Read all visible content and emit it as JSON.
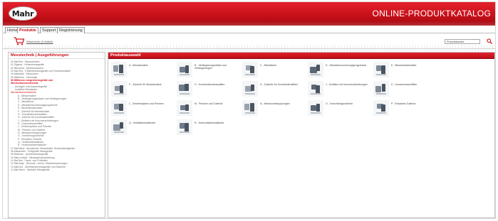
{
  "header": {
    "logo_text": "Mahr",
    "catalog_title": "ONLINE-PRODUKTKATALOG"
  },
  "nav": {
    "tabs": [
      {
        "label": "Home",
        "active": false
      },
      {
        "label": "Produkte",
        "active": true
      },
      {
        "label": "Support",
        "active": false
      },
      {
        "label": "Registrierung",
        "active": false
      }
    ]
  },
  "toolbar": {
    "cart_label": "Warenkorb (0 Artikel)",
    "search_value": "Produktsuche"
  },
  "left": {
    "title": "Messtechnik | Ausgeführungen",
    "items": [
      {
        "label": "00 MarTest - Messschieber",
        "style": "lvl1"
      },
      {
        "label": "01 Digimar - Höhenmessgeräte",
        "style": "lvl1"
      },
      {
        "label": "02 Micromar - Messschrauben",
        "style": "lvl1"
      },
      {
        "label": "03 MarTest - Fühlhebelmessgeräte und Fandmesstaster",
        "style": "lvl1"
      },
      {
        "label": "04 Marlsator - Messuhren",
        "style": "lvl1"
      },
      {
        "label": "05 Millimess - Feinzeiger",
        "style": "lvl1"
      },
      {
        "label": "06 Millimess Längenmessgeräte und",
        "style": "lvl1 red"
      },
      {
        "label": "Wechselkonverstechnik",
        "style": "lvl1 red"
      },
      {
        "label": "Anzeigen und Auswertegeräte",
        "style": "lvl2"
      },
      {
        "label": "Induktive Messtaster",
        "style": "lvl2"
      },
      {
        "label": "Wechselkonverstechnik",
        "style": "lvl1 redlink"
      },
      {
        "label": "A - Messeinsätze",
        "style": "lvl3"
      },
      {
        "label": "B - Verlängerungsstücke und Verlängerungen",
        "style": "lvl3"
      },
      {
        "label": "C - Messtische",
        "style": "lvl3"
      },
      {
        "label": "D - Messtischzuordnungsprogramme",
        "style": "lvl3"
      },
      {
        "label": "E - Blockmesseinsätze",
        "style": "lvl3"
      },
      {
        "label": "F - Zubehör für Messeinsätze",
        "style": "lvl3"
      },
      {
        "label": "G - Koordinatenmessstiften",
        "style": "lvl3"
      },
      {
        "label": "H - Zubehör für Koordinatenstiften",
        "style": "lvl3"
      },
      {
        "label": "J - Schlitten mit Kreuzverschiebungen",
        "style": "lvl3"
      },
      {
        "label": "K - Linearmessschlitten",
        "style": "lvl3"
      },
      {
        "label": "L - Zentrierspitzen und Prismen",
        "style": "lvl3"
      },
      {
        "label": "M - Prismen und Zubehör",
        "style": "lvl3"
      },
      {
        "label": "N - Messsonnekopplungen",
        "style": "lvl3"
      },
      {
        "label": "O - Vorrichtungszubehör",
        "style": "lvl3"
      },
      {
        "label": "P - Einsatzes Zubehör",
        "style": "lvl3"
      },
      {
        "label": "Q - Vertikalmessständer",
        "style": "lvl3"
      },
      {
        "label": "R - Horizontalmessständer",
        "style": "lvl3"
      },
      {
        "label": "07 MarStand - Messtische, Messstative, Rundlaufprüfgeräte",
        "style": "lvl1"
      },
      {
        "label": "08 Marameter - Prüfgeräte Messgeräte",
        "style": "lvl1"
      },
      {
        "label": "09 Multimar - Universalmessgeräte",
        "style": "lvl1"
      },
      {
        "label": "10 MarComsoft - Messdatenverarbeitung",
        "style": "lvl1"
      },
      {
        "label": "11 MarTest - Paper- und Prüfmittel",
        "style": "lvl1"
      },
      {
        "label": "12 MarGage - Normale, Lehren, Maßverkörperungen",
        "style": "lvl1"
      },
      {
        "label": "13 MarSurf - Oberflächenmessgeräte und Systeme",
        "style": "lvl1"
      },
      {
        "label": "14 MarVision - Optische Messgeräte",
        "style": "lvl1"
      }
    ]
  },
  "right": {
    "title": "Produktauswahl",
    "products": [
      {
        "label": "A - Messeinsätze",
        "icon": "measuring-insert-icon"
      },
      {
        "label": "B - Verlängerungsstücke und Verlängerungen",
        "icon": "extension-icon"
      },
      {
        "label": "C - Messtische",
        "icon": "measuring-table-icon"
      },
      {
        "label": "D - Messtischzuordnungsprogramme",
        "icon": "table-program-icon"
      },
      {
        "label": "E - Blockmesseinsätze",
        "icon": "block-insert-icon"
      },
      {
        "label": "F - Zubehör für Messeinsätze",
        "icon": "insert-accessory-icon"
      },
      {
        "label": "G - Koordinatenmessstiften",
        "icon": "coordinate-pin-icon"
      },
      {
        "label": "H - Zubehör für Koordinatenstiften",
        "icon": "pin-accessory-icon"
      },
      {
        "label": "J - Schlitten mit Kreuzverschiebungen",
        "icon": "cross-slide-icon"
      },
      {
        "label": "K - Linearmessschlitten",
        "icon": "linear-slide-icon"
      },
      {
        "label": "L - Zentrierspitzen und Prismen",
        "icon": "centering-tip-icon"
      },
      {
        "label": "M - Prismen und Zubehör",
        "icon": "prism-icon"
      },
      {
        "label": "N - Messsonnekopplungen",
        "icon": "coupling-icon"
      },
      {
        "label": "O - Vorrichtungszubehör",
        "icon": "fixture-accessory-icon"
      },
      {
        "label": "P - Einsatzes Zubehör",
        "icon": "insert-accessory-2-icon"
      },
      {
        "label": "Q - Vertikalmessständer",
        "icon": "vertical-stand-icon"
      },
      {
        "label": "R - Horizontalmessständer",
        "icon": "horizontal-stand-icon"
      }
    ]
  },
  "colors": {
    "brand_red": "#c8101a",
    "link_red": "#d8101c"
  }
}
